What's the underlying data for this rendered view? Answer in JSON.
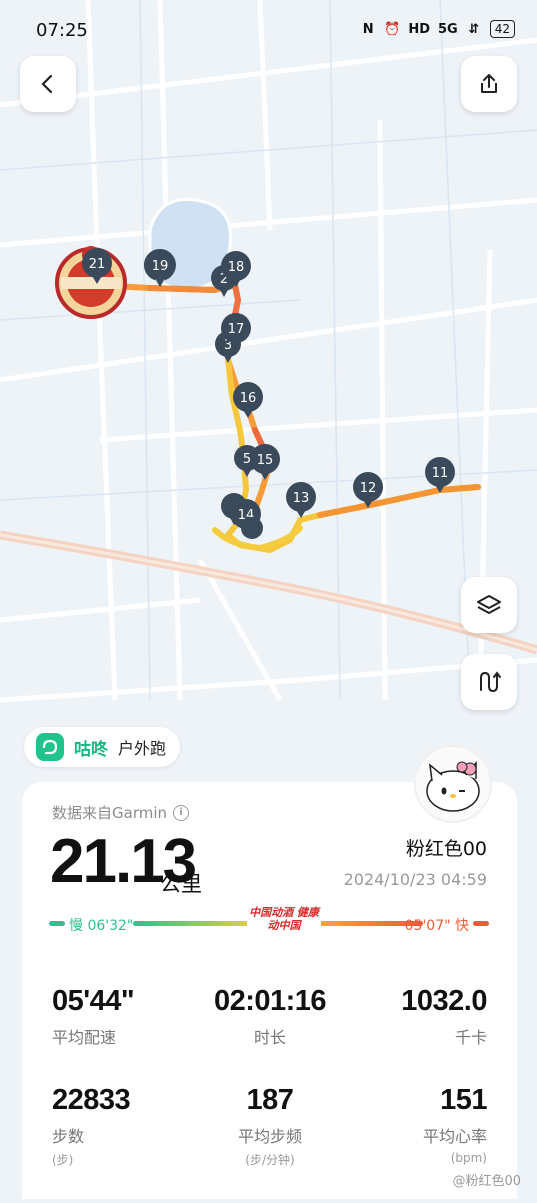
{
  "status_bar": {
    "time": "07:25",
    "battery": "42",
    "icons": [
      "N",
      "⏰",
      "HD",
      "5G",
      "⇵"
    ]
  },
  "map": {
    "markers": [
      {
        "label": "21"
      },
      {
        "label": "19"
      },
      {
        "label": "18"
      },
      {
        "label": "2"
      },
      {
        "label": "17"
      },
      {
        "label": "3"
      },
      {
        "label": "16"
      },
      {
        "label": "5"
      },
      {
        "label": "15"
      },
      {
        "label": "13"
      },
      {
        "label": "12"
      },
      {
        "label": "11"
      },
      {
        "label": "14"
      }
    ],
    "route_colors": {
      "slow": "#f5d23a",
      "mid": "#f8a033",
      "fast": "#ee6a3a"
    }
  },
  "app": {
    "name": "咕咚",
    "activity": "户外跑"
  },
  "summary": {
    "source": "数据来自Garmin",
    "distance": "21.13",
    "distance_unit": "公里",
    "user_name": "粉红色00",
    "datetime": "2024/10/23 04:59",
    "pace_slow": "慢 06'32\"",
    "pace_fast": "05'07\" 快",
    "badge_text": "中国动酒 健康动中国"
  },
  "stats": [
    {
      "value": "05'44\"",
      "label": "平均配速",
      "unit": ""
    },
    {
      "value": "02:01:16",
      "label": "时长",
      "unit": ""
    },
    {
      "value": "1032.0",
      "label": "千卡",
      "unit": ""
    },
    {
      "value": "22833",
      "label": "步数",
      "unit": "(步)"
    },
    {
      "value": "187",
      "label": "平均步频",
      "unit": "(步/分钟)"
    },
    {
      "value": "151",
      "label": "平均心率",
      "unit": "(bpm)"
    }
  ],
  "watermark": "@粉红色00",
  "colors": {
    "accent_green": "#20c38a",
    "pace_fast": "#ee5a3a",
    "pace_slow": "#2fc08e"
  }
}
